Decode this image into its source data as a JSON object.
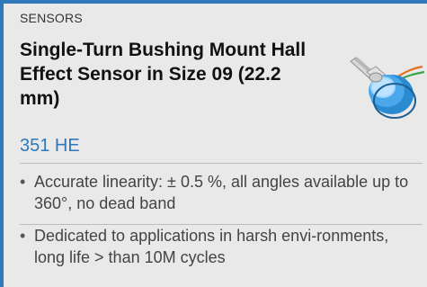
{
  "card": {
    "category": "SENSORS",
    "title": "Single-Turn Bushing Mount Hall Effect Sensor in Size 09 (22.2 mm)",
    "model": "351 HE",
    "features": [
      "Accurate linearity: ± 0.5 %, all angles available up to 360°, no dead band",
      "Dedicated to applications in harsh envi-ronments, long life > than 10M cycles"
    ],
    "image_icon": "hall-effect-sensor-icon"
  },
  "colors": {
    "accent": "#2f78b9",
    "background": "#e9e9e9",
    "title": "#111111",
    "body_text": "#444444"
  }
}
